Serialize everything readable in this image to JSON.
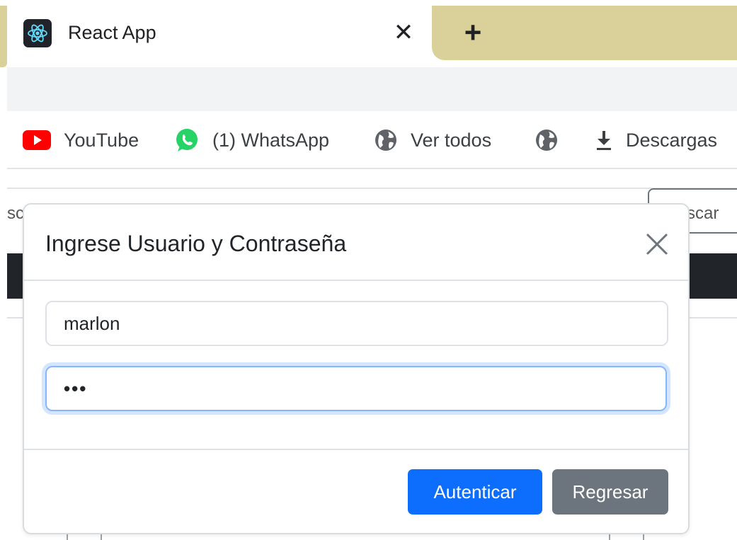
{
  "browser": {
    "tab": {
      "title": "React App",
      "favicon": "react-logo-icon"
    },
    "close_glyph": "✕",
    "new_tab_glyph": "+",
    "bookmarks": [
      {
        "label": "YouTube",
        "icon": "youtube-icon"
      },
      {
        "label": "(1) WhatsApp",
        "icon": "whatsapp-icon"
      },
      {
        "label": "Ver todos",
        "icon": "globe-icon"
      },
      {
        "label": "",
        "icon": "globe-icon"
      },
      {
        "label": "Descargas",
        "icon": "download-icon"
      }
    ]
  },
  "page": {
    "search_fragment_left": "sc",
    "search_button_fragment": "scar"
  },
  "modal": {
    "title": "Ingrese Usuario y Contraseña",
    "username_value": "marlon",
    "password_value": "•••",
    "auth_label": "Autenticar",
    "back_label": "Regresar"
  },
  "colors": {
    "primary": "#0d6efd",
    "secondary": "#6c757d",
    "tab_strip": "#d9d09a",
    "dark_bar": "#212529",
    "focus_ring": "#86b7fe"
  }
}
